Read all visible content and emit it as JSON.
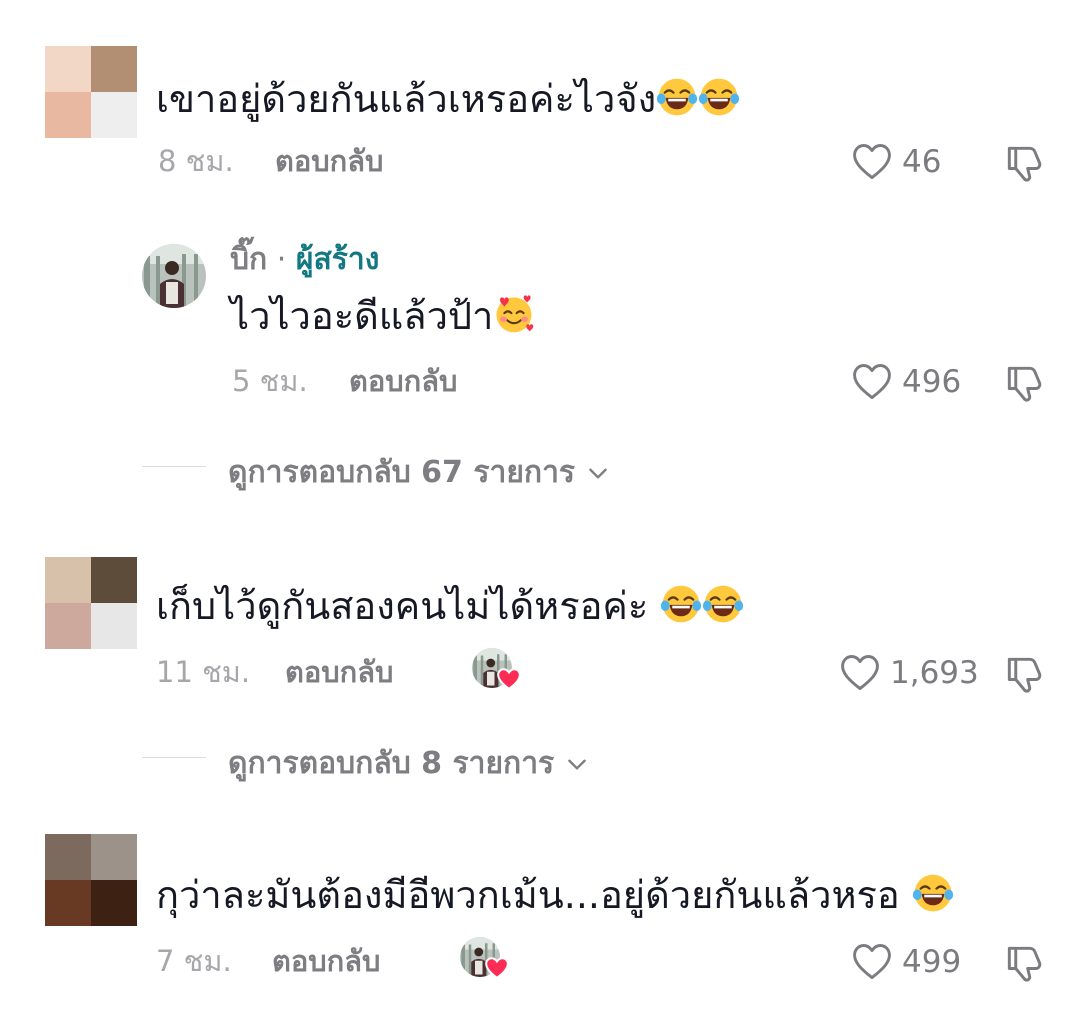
{
  "comments": [
    {
      "text": "เขาอยู่ด้วยกันแล้วเหรอค่ะไวจัง",
      "emoji": [
        "laugh-cry",
        "laugh-cry"
      ],
      "time": "8 ชม.",
      "reply_label": "ตอบกลับ",
      "likes": "46",
      "avatar_colors": [
        "#f2d6c6",
        "#b28f73",
        "#e8b9a0",
        "#eeeeee"
      ]
    },
    {
      "text": "เก็บไว้ดูกันสองคนไม่ได้หรอค่ะ",
      "emoji": [
        "laugh-cry",
        "laugh-cry"
      ],
      "time": "11 ชม.",
      "reply_label": "ตอบกลับ",
      "likes": "1,693",
      "avatar_colors": [
        "#d8c1ab",
        "#5e4c3a",
        "#cca99c",
        "#e7e7e7"
      ],
      "view_replies": "ดูการตอบกลับ 8 รายการ"
    },
    {
      "text": "กุว่าละมันต้องมีอีพวกเม้น...อยู่ด้วยกันแล้วหรอ",
      "emoji": [
        "laugh-cry"
      ],
      "time": "7 ชม.",
      "reply_label": "ตอบกลับ",
      "likes": "499",
      "avatar_colors": [
        "#7c6a5e",
        "#9c928a",
        "#693a23",
        "#3d2113"
      ]
    }
  ],
  "creator_reply": {
    "username": "บิ๊ก",
    "separator": "·",
    "creator_tag": "ผู้สร้าง",
    "text": "ไวไวอะดีแล้วป้า",
    "emoji": [
      "smiling-hearts"
    ],
    "time": "5 ชม.",
    "reply_label": "ตอบกลับ",
    "likes": "496",
    "view_replies": "ดูการตอบกลับ 67 รายการ"
  },
  "icons": {
    "like": "heart-outline-icon",
    "dislike": "thumbs-down-icon",
    "expand": "chevron-down-icon",
    "creator_liked": "heart-badge-icon"
  },
  "colors": {
    "text": "#161823",
    "muted": "#7d7d82",
    "creator_tag": "#127883",
    "heart_badge": "#fe2c55"
  }
}
